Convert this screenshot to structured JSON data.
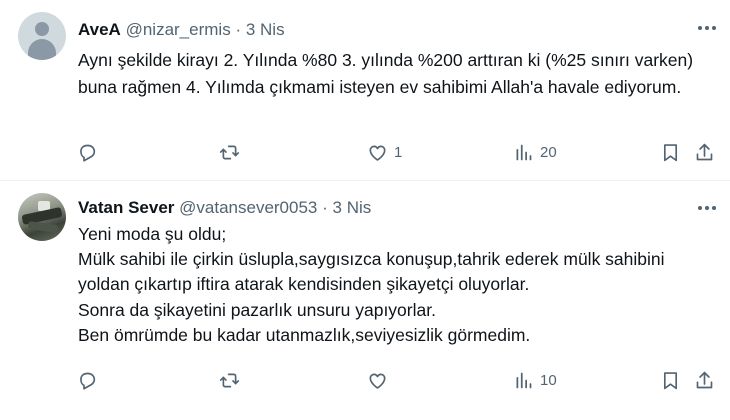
{
  "tweets": [
    {
      "name": "AveA",
      "handle": "@nizar_ermis",
      "separator": "·",
      "date": "3 Nis",
      "text": "Aynı şekilde kirayı 2. Yılında %80 3. yılında %200 arttıran ki (%25 sınırı varken) buna rağmen 4. Yılımda çıkmami isteyen ev sahibimi Allah'a havale ediyorum.",
      "likes": "1",
      "views": "20",
      "avatar": "default-avatar"
    },
    {
      "name": "Vatan Sever",
      "handle": "@vatansever0053",
      "separator": "·",
      "date": "3 Nis",
      "text": "Yeni moda şu oldu;\nMülk sahibi ile çirkin üslupla,saygısızca konuşup,tahrik ederek mülk sahibini yoldan çıkartıp iftira atarak kendisinden şikayetçi oluyorlar.\nSonra da şikayetini pazarlık unsuru yapıyorlar.\nBen ömrümde bu kadar utanmazlık,seviyesizlik görmedim.",
      "likes": "",
      "views": "10",
      "avatar": "photo-avatar"
    }
  ],
  "icons": {
    "more": "more-horizontal-icon",
    "reply": "reply-icon",
    "retweet": "retweet-icon",
    "like": "heart-icon",
    "views": "views-bar-chart-icon",
    "bookmark": "bookmark-icon",
    "share": "share-upload-icon"
  },
  "colors": {
    "text": "#0f1419",
    "secondary": "#536471",
    "divider": "#eff3f4"
  }
}
